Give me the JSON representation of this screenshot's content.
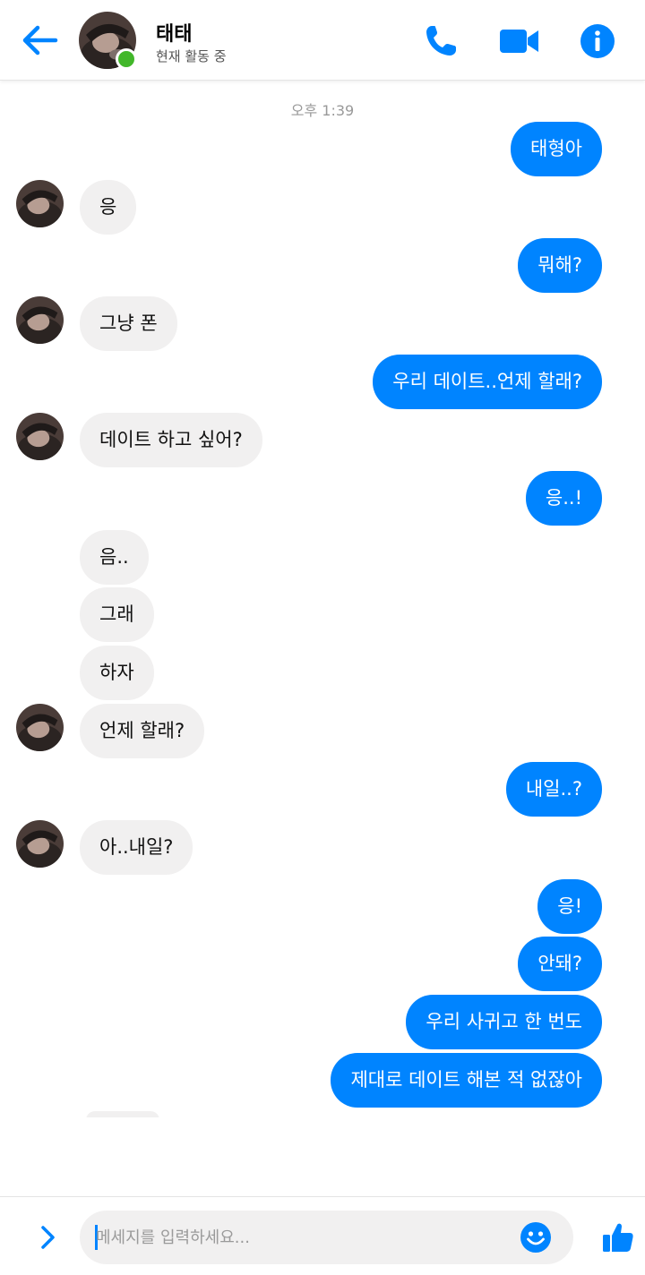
{
  "header": {
    "contact_name": "태태",
    "contact_status": "현재 활동 중",
    "accent_color": "#0084ff",
    "online_color": "#42b72a",
    "icons": [
      "back-arrow-icon",
      "phone-icon",
      "video-camera-icon",
      "info-icon"
    ]
  },
  "conversation": {
    "timestamp": "오후 1:39",
    "messages": [
      {
        "from": "me",
        "text": "태형아"
      },
      {
        "from": "them",
        "text": "응"
      },
      {
        "from": "me",
        "text": "뭐해?"
      },
      {
        "from": "them",
        "text": "그냥 폰"
      },
      {
        "from": "me",
        "text": "우리 데이트..언제 할래?"
      },
      {
        "from": "them",
        "text": "데이트 하고 싶어?"
      },
      {
        "from": "me",
        "text": "응..!"
      },
      {
        "from": "them",
        "text": "음.."
      },
      {
        "from": "them",
        "text": "그래"
      },
      {
        "from": "them",
        "text": "하자"
      },
      {
        "from": "them",
        "text": "언제 할래?"
      },
      {
        "from": "me",
        "text": "내일..?"
      },
      {
        "from": "them",
        "text": "아..내일?"
      },
      {
        "from": "me",
        "text": "응!"
      },
      {
        "from": "me",
        "text": "안돼?"
      },
      {
        "from": "me",
        "text": "우리 사귀고 한 번도"
      },
      {
        "from": "me",
        "text": "제대로 데이트 해본 적 없잖아"
      }
    ],
    "incoming_bubble_color": "#f1f0f0",
    "outgoing_bubble_color": "#0084ff"
  },
  "composer": {
    "placeholder": "메세지를 입력하세요...",
    "value": "",
    "icons": [
      "chevron-right-icon",
      "emoji-icon",
      "thumbs-up-icon"
    ]
  }
}
